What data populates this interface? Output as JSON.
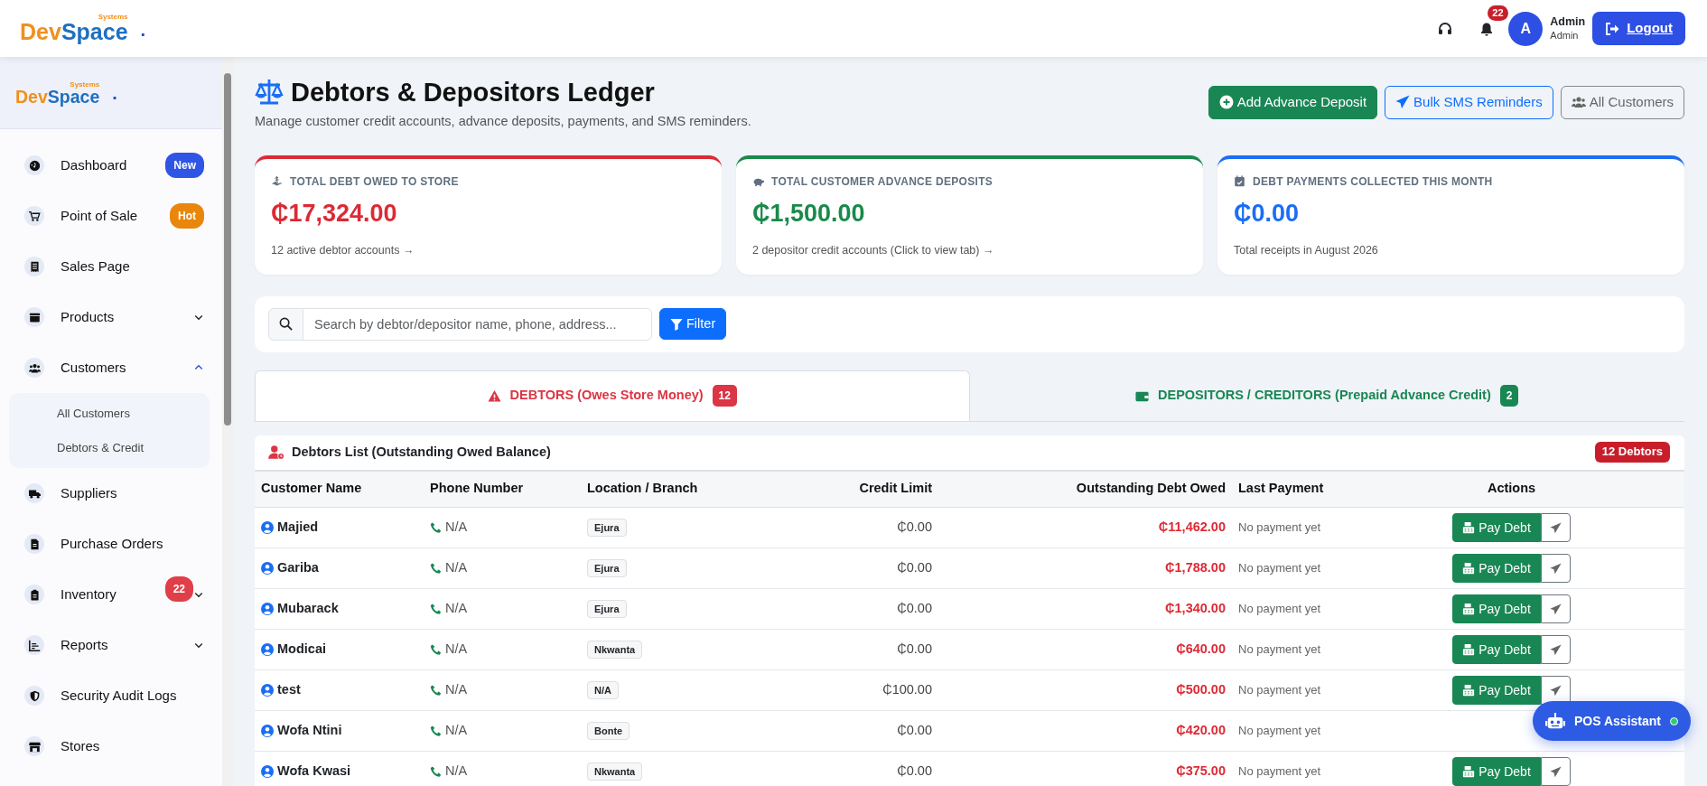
{
  "topbar": {
    "logo": {
      "brand_a": "Dev",
      "brand_b": "Space",
      "tagline": "Systems",
      "dot": "."
    },
    "notifications": "22",
    "avatar": "A",
    "user_name": "Admin",
    "user_role": "Admin",
    "logout": "Logout"
  },
  "sidebar": {
    "logo": {
      "brand_a": "Dev",
      "brand_b": "Space",
      "tagline": "Systems",
      "dot": "."
    },
    "items": [
      {
        "label": "Dashboard",
        "badge": {
          "text": "New",
          "color": "#2f55e4"
        }
      },
      {
        "label": "Point of Sale",
        "badge": {
          "text": "Hot",
          "color": "#e8870c"
        }
      },
      {
        "label": "Sales Page"
      },
      {
        "label": "Products",
        "expanded": false
      },
      {
        "label": "Customers",
        "expanded": true,
        "children": [
          {
            "label": "All Customers"
          },
          {
            "label": "Debtors & Credit"
          }
        ]
      },
      {
        "label": "Suppliers"
      },
      {
        "label": "Purchase Orders"
      },
      {
        "label": "Inventory",
        "expanded": false,
        "badge": {
          "text": "22",
          "color": "#e03e48"
        }
      },
      {
        "label": "Reports",
        "expanded": false
      },
      {
        "label": "Security Audit Logs"
      },
      {
        "label": "Stores"
      }
    ]
  },
  "page": {
    "title": "Debtors & Depositors Ledger",
    "subtitle": "Manage customer credit accounts, advance deposits, payments, and SMS reminders.",
    "buttons": [
      {
        "kind": "success",
        "label": "Add Advance Deposit"
      },
      {
        "kind": "outline-primary",
        "label": "Bulk SMS Reminders"
      },
      {
        "kind": "outline-secondary",
        "label": "All Customers"
      }
    ]
  },
  "stats": [
    {
      "label": "TOTAL DEBT OWED TO STORE",
      "value": "₵17,324.00",
      "note": "12 active debtor accounts →",
      "color": "#dc2a35"
    },
    {
      "label": "TOTAL CUSTOMER ADVANCE DEPOSITS",
      "value": "₵1,500.00",
      "note": "2 depositor credit accounts (Click to view tab) →",
      "color": "#198a4a"
    },
    {
      "label": "DEBT PAYMENTS COLLECTED THIS MONTH",
      "value": "₵0.00",
      "note": "Total receipts in August 2026",
      "color": "#1a6ef5"
    }
  ],
  "search": {
    "placeholder": "Search by debtor/depositor name, phone, address...",
    "button": "Filter"
  },
  "tabs": [
    {
      "label": "DEBTORS (Owes Store Money)",
      "count": "12",
      "color": "#dc3545",
      "selected": true
    },
    {
      "label": "DEPOSITORS / CREDITORS (Prepaid Advance Credit)",
      "count": "2",
      "color": "#198754",
      "selected": false
    }
  ],
  "table": {
    "title": "Debtors List (Outstanding Owed Balance)",
    "count_badge": "12 Debtors",
    "columns": [
      "Customer Name",
      "Phone Number",
      "Location / Branch",
      "Credit Limit",
      "Outstanding Debt Owed",
      "Last Payment",
      "Actions"
    ],
    "rows": [
      {
        "name": "Majied",
        "phone": "N/A",
        "location": "Ejura",
        "credit_limit": "₵0.00",
        "debt": "₵11,462.00",
        "last_payment": "No payment yet",
        "action": "Pay Debt"
      },
      {
        "name": "Gariba",
        "phone": "N/A",
        "location": "Ejura",
        "credit_limit": "₵0.00",
        "debt": "₵1,788.00",
        "last_payment": "No payment yet",
        "action": "Pay Debt"
      },
      {
        "name": "Mubarack",
        "phone": "N/A",
        "location": "Ejura",
        "credit_limit": "₵0.00",
        "debt": "₵1,340.00",
        "last_payment": "No payment yet",
        "action": "Pay Debt"
      },
      {
        "name": "Modicai",
        "phone": "N/A",
        "location": "Nkwanta",
        "credit_limit": "₵0.00",
        "debt": "₵640.00",
        "last_payment": "No payment yet",
        "action": "Pay Debt"
      },
      {
        "name": "test",
        "phone": "N/A",
        "location": "N/A",
        "credit_limit": "₵100.00",
        "debt": "₵500.00",
        "last_payment": "No payment yet",
        "action": "Pay Debt"
      },
      {
        "name": "Wofa Ntini",
        "phone": "N/A",
        "location": "Bonte",
        "credit_limit": "₵0.00",
        "debt": "₵420.00",
        "last_payment": "No payment yet"
      },
      {
        "name": "Wofa Kwasi",
        "phone": "N/A",
        "location": "Nkwanta",
        "credit_limit": "₵0.00",
        "debt": "₵375.00",
        "last_payment": "No payment yet",
        "action": "Pay Debt"
      }
    ]
  },
  "assistant": {
    "label": "POS Assistant",
    "online": true
  }
}
